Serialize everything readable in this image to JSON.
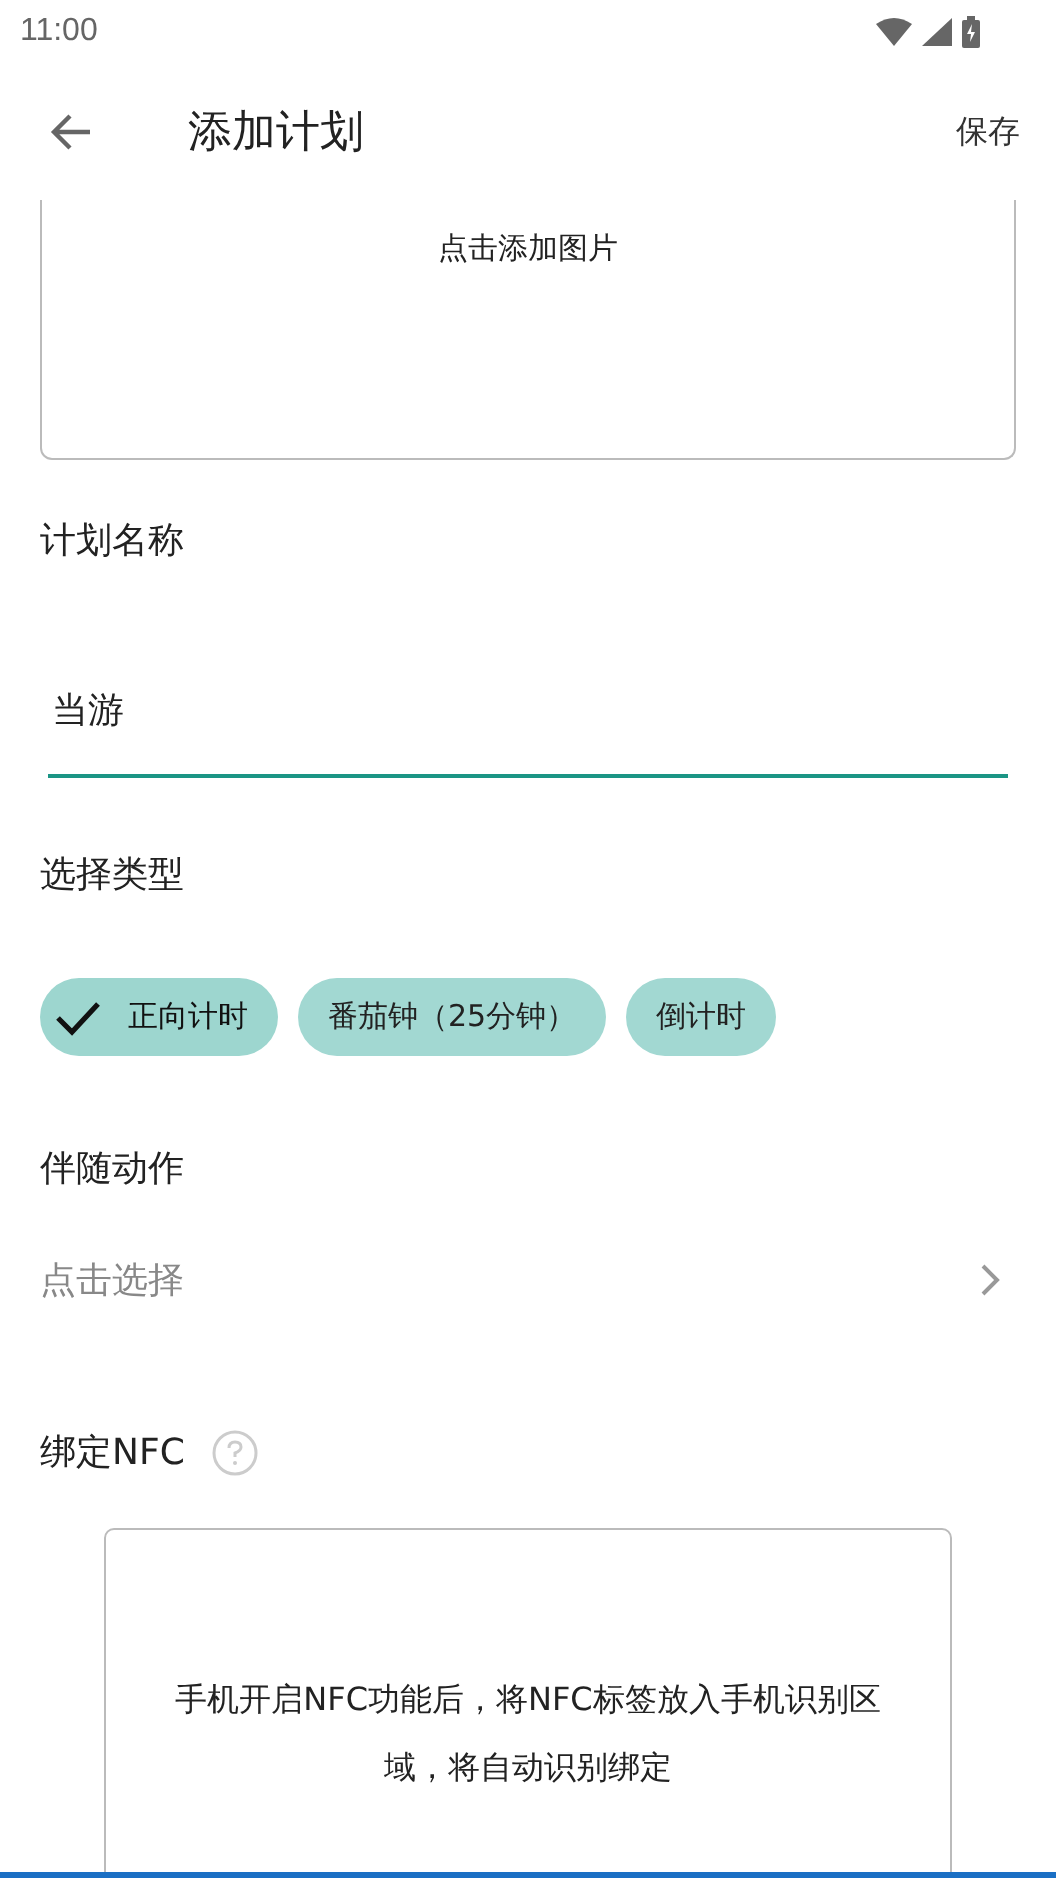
{
  "status_bar": {
    "time": "11:00"
  },
  "app_bar": {
    "title": "添加计划",
    "action": "保存"
  },
  "image_picker": {
    "label": "点击添加图片"
  },
  "name_section": {
    "label": "计划名称",
    "value": "当游"
  },
  "type_section": {
    "label": "选择类型",
    "chips": [
      {
        "label": "正向计时",
        "selected": true
      },
      {
        "label": "番茄钟（25分钟）",
        "selected": false
      },
      {
        "label": "倒计时",
        "selected": false
      }
    ]
  },
  "action_section": {
    "label": "伴随动作",
    "placeholder": "点击选择"
  },
  "nfc_section": {
    "label": "绑定NFC",
    "hint": "手机开启NFC功能后，将NFC标签放入手机识别区域，将自动识别绑定"
  }
}
